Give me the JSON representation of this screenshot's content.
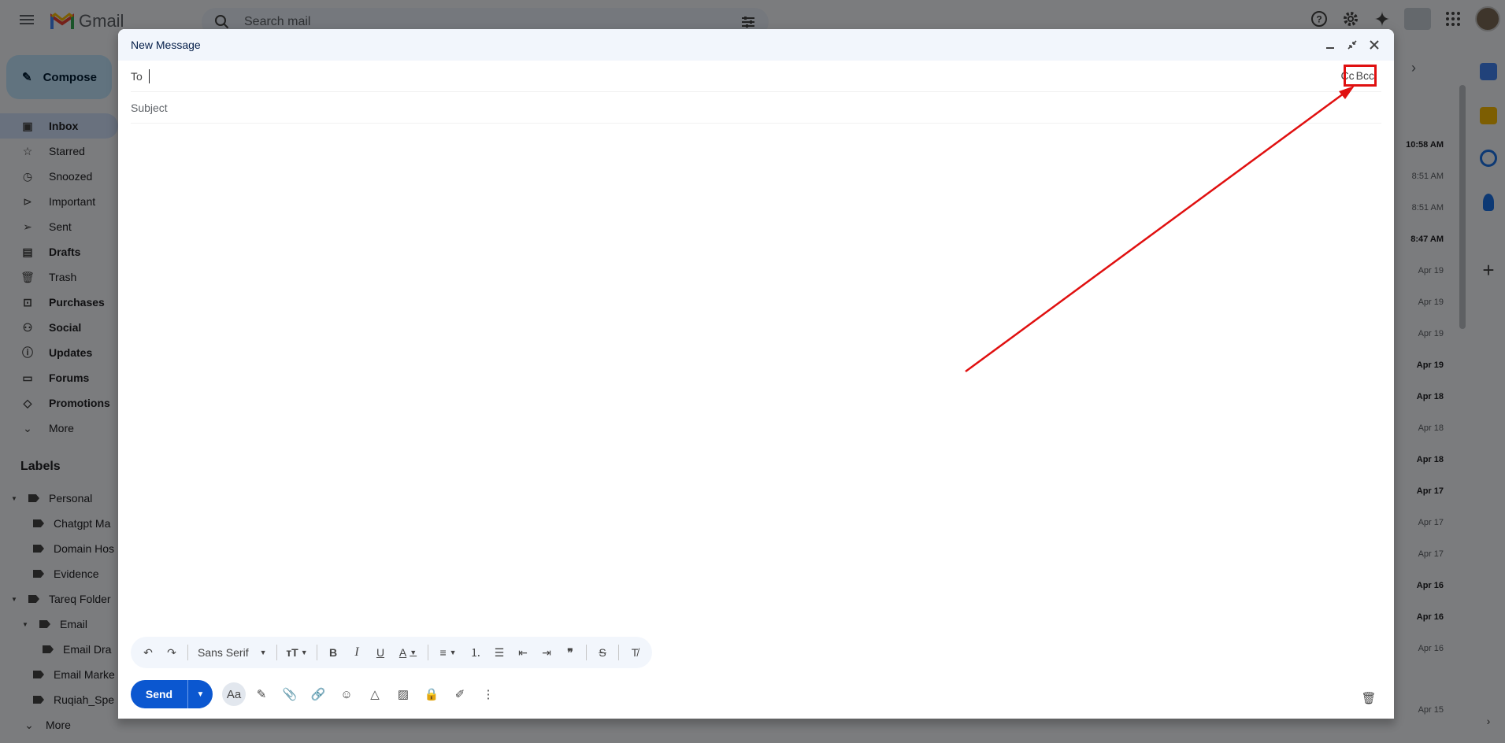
{
  "app": {
    "name": "Gmail"
  },
  "search": {
    "placeholder": "Search mail"
  },
  "compose_button": {
    "label": "Compose"
  },
  "nav": {
    "items": [
      {
        "label": "Inbox",
        "icon": "inbox-icon"
      },
      {
        "label": "Starred",
        "icon": "star-icon"
      },
      {
        "label": "Snoozed",
        "icon": "clock-icon"
      },
      {
        "label": "Important",
        "icon": "important-icon"
      },
      {
        "label": "Sent",
        "icon": "send-icon"
      },
      {
        "label": "Drafts",
        "icon": "draft-icon"
      },
      {
        "label": "Trash",
        "icon": "trash-icon"
      },
      {
        "label": "Purchases",
        "icon": "tag-icon"
      },
      {
        "label": "Social",
        "icon": "people-icon"
      },
      {
        "label": "Updates",
        "icon": "info-icon"
      },
      {
        "label": "Forums",
        "icon": "forum-icon"
      },
      {
        "label": "Promotions",
        "icon": "tag-icon"
      },
      {
        "label": "More",
        "icon": "chevron-down-icon"
      }
    ]
  },
  "labels": {
    "heading": "Labels",
    "items": [
      {
        "label": "Personal"
      },
      {
        "label": "Chatgpt Ma"
      },
      {
        "label": "Domain Hos"
      },
      {
        "label": "Evidence"
      },
      {
        "label": "Tareq Folder"
      },
      {
        "label": "Email"
      },
      {
        "label": "Email Dra"
      },
      {
        "label": "Email Marke"
      },
      {
        "label": "Ruqiah_Spe"
      },
      {
        "label": "More"
      }
    ]
  },
  "dates": [
    {
      "text": "10:58 AM",
      "bold": true
    },
    {
      "text": "8:51 AM",
      "bold": false
    },
    {
      "text": "8:51 AM",
      "bold": false
    },
    {
      "text": "8:47 AM",
      "bold": true
    },
    {
      "text": "Apr 19",
      "bold": false
    },
    {
      "text": "Apr 19",
      "bold": false
    },
    {
      "text": "Apr 19",
      "bold": false
    },
    {
      "text": "Apr 19",
      "bold": true
    },
    {
      "text": "Apr 18",
      "bold": true
    },
    {
      "text": "Apr 18",
      "bold": false
    },
    {
      "text": "Apr 18",
      "bold": true
    },
    {
      "text": "Apr 17",
      "bold": true
    },
    {
      "text": "Apr 17",
      "bold": false
    },
    {
      "text": "Apr 17",
      "bold": false
    },
    {
      "text": "Apr 16",
      "bold": true
    },
    {
      "text": "Apr 16",
      "bold": true
    },
    {
      "text": "Apr 16",
      "bold": false
    },
    {
      "text": "Apr 15",
      "bold": false
    }
  ],
  "compose": {
    "title": "New Message",
    "to_label": "To",
    "cc_label": "Cc",
    "bcc_label": "Bcc",
    "subject_placeholder": "Subject",
    "font_name": "Sans Serif",
    "send_label": "Send",
    "format_label": "Aa"
  },
  "colors": {
    "accent": "#0b57d0",
    "highlight": "#e01010"
  }
}
